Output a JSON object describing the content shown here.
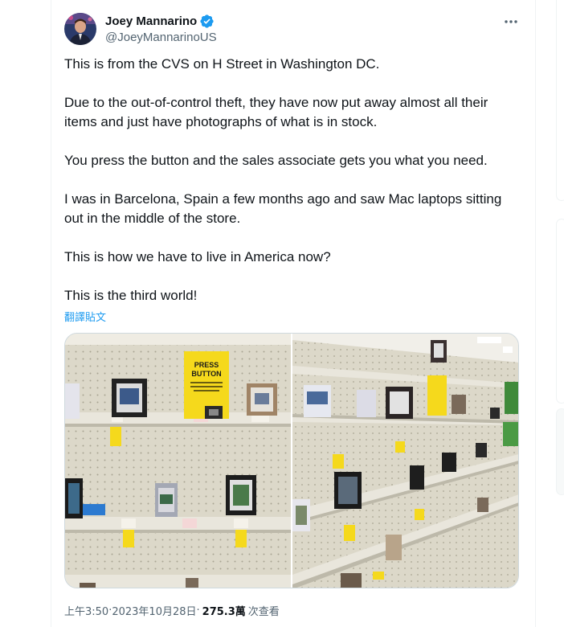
{
  "author": {
    "name": "Joey Mannarino",
    "handle": "@JoeyMannarinoUS",
    "verified": true,
    "badge_color": "#1d9bf0"
  },
  "more_icon": "ellipsis-icon",
  "tweet": {
    "paragraphs": [
      "This is from the CVS on H Street in Washington DC.",
      "Due to the out-of-control theft, they have now put away almost all their items and just have photographs of what is in stock.",
      "You press the button and the sales associate gets you what you need.",
      "I was in Barcelona, Spain a few months ago and saw Mac laptops sitting out in the middle of the store.",
      "This is how we have to live in America now?",
      "This is the third world!"
    ],
    "translate_label": "翻譯貼文"
  },
  "media": {
    "sign_line1": "PRESS",
    "sign_line2": "BUTTON",
    "sign_color": "#f5d91c"
  },
  "meta": {
    "time": "上午3:50",
    "sep1": " · ",
    "date": "2023年10月28日",
    "sep2": " · ",
    "views": "275.3萬",
    "views_label": "次查看"
  }
}
